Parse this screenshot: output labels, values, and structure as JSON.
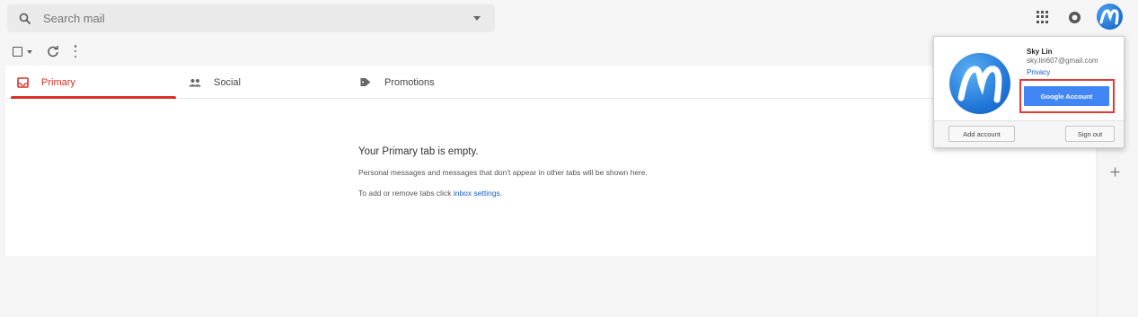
{
  "search": {
    "placeholder": "Search mail",
    "icon": "search-icon"
  },
  "header_icons": [
    "apps-grid-icon",
    "notifications-icon",
    "account-avatar-icon"
  ],
  "toolbar": {
    "icons": [
      "select-checkbox-icon",
      "checkbox-dropdown-icon",
      "refresh-icon",
      "more-vert-icon"
    ]
  },
  "tabs": [
    {
      "label": "Primary",
      "icon": "inbox-icon",
      "active": true
    },
    {
      "label": "Social",
      "icon": "people-icon",
      "active": false
    },
    {
      "label": "Promotions",
      "icon": "tag-icon",
      "active": false
    }
  ],
  "empty_state": {
    "title": "Your Primary tab is empty.",
    "line1": "Personal messages and messages that don't appear in other tabs will be shown here.",
    "line2_prefix": "To add or remove tabs click ",
    "line2_link": "inbox settings",
    "line2_suffix": "."
  },
  "account_popup": {
    "name": "Sky Lin",
    "email": "sky.lin607@gmail.com",
    "privacy_label": "Privacy",
    "google_account_label": "Google Account",
    "add_account_label": "Add account",
    "sign_out_label": "Sign out"
  },
  "colors": {
    "accent_red": "#d93025",
    "google_blue": "#4285f4",
    "link_blue": "#1a5dc8",
    "highlight_red": "#e53935"
  }
}
